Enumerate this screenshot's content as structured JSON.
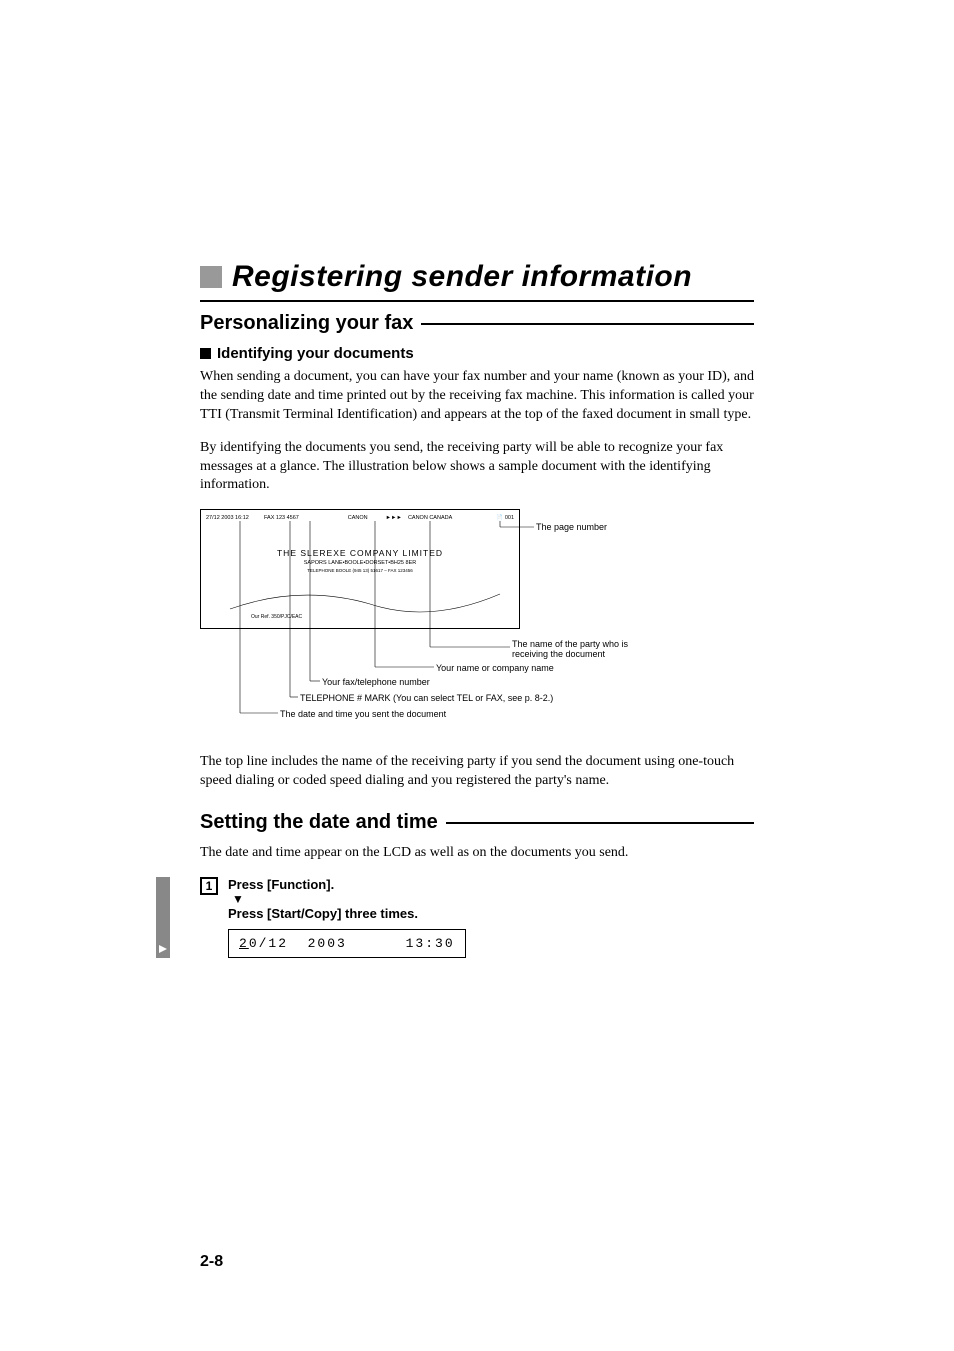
{
  "title": "Registering sender information",
  "h2a": "Personalizing your fax",
  "h3a": "Identifying your documents",
  "para1": "When sending a document, you can have your fax number and your name (known as your ID), and the sending date and time printed out by the receiving fax machine. This information is called your TTI (Transmit Terminal Identification) and appears at the top of the faxed document in small type.",
  "para2": "By identifying the documents you send, the receiving party will be able to recognize your fax messages at a glance. The illustration below shows a sample document with the identifying information.",
  "fax": {
    "datetime": "27/12 2003  16:12",
    "faxno": "FAX 123 4567",
    "sender": "CANON",
    "arrows": "►►►",
    "recipient": "CANON CANADA",
    "page_icon": "📄",
    "page": "001",
    "company": "THE SLEREXE COMPANY LIMITED",
    "addr1": "SAPORS LANE•BOOLE•DORSET•BH25 8ER",
    "addr2": "TELEPHONE BOOLE (945 13) 51617 – FAX 123456",
    "ref": "Our Ref. 350/PJC/EAC"
  },
  "callouts": {
    "page_number": "The page number",
    "recipient": "The name of the party who is",
    "recipient2": "receiving the document",
    "sender_name": "Your name or company name",
    "faxtel": "Your fax/telephone number",
    "mark": "TELEPHONE # MARK (You can select TEL or FAX, see p. 8-2.)",
    "datetime": "The date and time you sent the document"
  },
  "para3": "The top line includes the name of the receiving party if you send the document using one-touch speed dialing or coded speed dialing and you registered the party's name.",
  "h2b": "Setting the date and time",
  "para4": "The date and time appear on the LCD as well as on the documents you send.",
  "step": {
    "num": "1",
    "line1": "Press [Function].",
    "line2": "Press [Start/Copy] three times.",
    "lcd_u": "2",
    "lcd_rest": "0/12  2003      13:30"
  },
  "page_num": "2-8"
}
